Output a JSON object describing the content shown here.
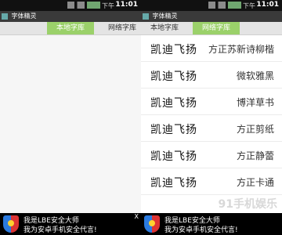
{
  "status": {
    "period": "下午",
    "time": "11:01"
  },
  "app_title": "字体精灵",
  "tabs": {
    "local": "本地字库",
    "network": "网络字库"
  },
  "fonts": [
    {
      "sample": "凯迪飞扬",
      "name": "方正苏新诗柳楷"
    },
    {
      "sample": "凯迪飞扬",
      "name": "微软雅黑"
    },
    {
      "sample": "凯迪飞扬",
      "name": "博洋草书"
    },
    {
      "sample": "凯迪飞扬",
      "name": "方正剪纸"
    },
    {
      "sample": "凯迪飞扬",
      "name": "方正静蕾"
    },
    {
      "sample": "凯迪飞扬",
      "name": "方正卡通"
    }
  ],
  "ad": {
    "line1": "我是LBE安全大师",
    "line2": "我为安卓手机安全代言!",
    "close": "X"
  },
  "watermark": "91手机娱乐"
}
